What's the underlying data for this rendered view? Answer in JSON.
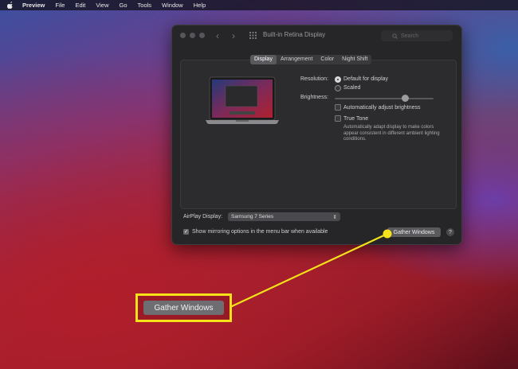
{
  "menubar": {
    "items": [
      "Preview",
      "File",
      "Edit",
      "View",
      "Go",
      "Tools",
      "Window",
      "Help"
    ]
  },
  "window": {
    "title": "Built-in Retina Display",
    "search_placeholder": "Search",
    "tabs": [
      "Display",
      "Arrangement",
      "Color",
      "Night Shift"
    ],
    "active_tab": "Display"
  },
  "display": {
    "resolution_label": "Resolution:",
    "resolution_options": [
      "Default for display",
      "Scaled"
    ],
    "brightness_label": "Brightness:",
    "brightness_level": 0.71,
    "auto_brightness_label": "Automatically adjust brightness",
    "true_tone_label": "True Tone",
    "true_tone_desc": "Automatically adapt display to make colors appear consistent in different ambient lighting conditions."
  },
  "footer": {
    "airplay_label": "AirPlay Display:",
    "airplay_value": "Samsung 7 Series",
    "mirroring_label": "Show mirroring options in the menu bar when available",
    "gather_label": "Gather Windows",
    "help_label": "?"
  },
  "callout": {
    "label": "Gather Windows",
    "color": "#f5e21a"
  }
}
